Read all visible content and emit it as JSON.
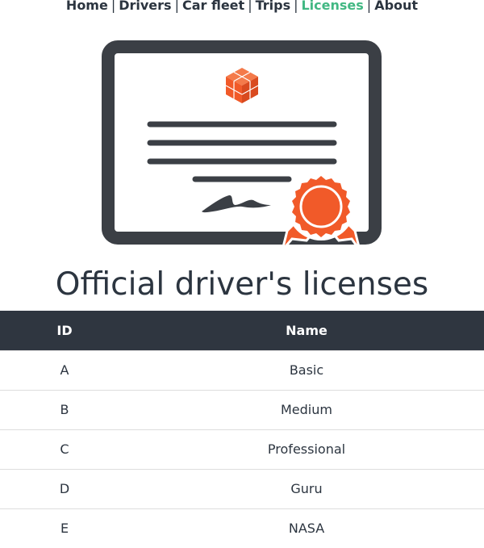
{
  "nav": {
    "items": [
      {
        "label": "Home",
        "active": false
      },
      {
        "label": "Drivers",
        "active": false
      },
      {
        "label": "Car fleet",
        "active": false
      },
      {
        "label": "Trips",
        "active": false
      },
      {
        "label": "Licenses",
        "active": true
      },
      {
        "label": "About",
        "active": false
      }
    ],
    "separator": "|",
    "active_color": "#42b883"
  },
  "hero": {
    "icon": "certificate-illustration",
    "colors": {
      "frame": "#3b3f45",
      "accent": "#f15a29"
    }
  },
  "page": {
    "title": "Official driver's licenses"
  },
  "table": {
    "columns": [
      "ID",
      "Name"
    ],
    "rows": [
      {
        "id": "A",
        "name": "Basic"
      },
      {
        "id": "B",
        "name": "Medium"
      },
      {
        "id": "C",
        "name": "Professional"
      },
      {
        "id": "D",
        "name": "Guru"
      },
      {
        "id": "E",
        "name": "NASA"
      }
    ],
    "header_color": "#2f3640"
  }
}
